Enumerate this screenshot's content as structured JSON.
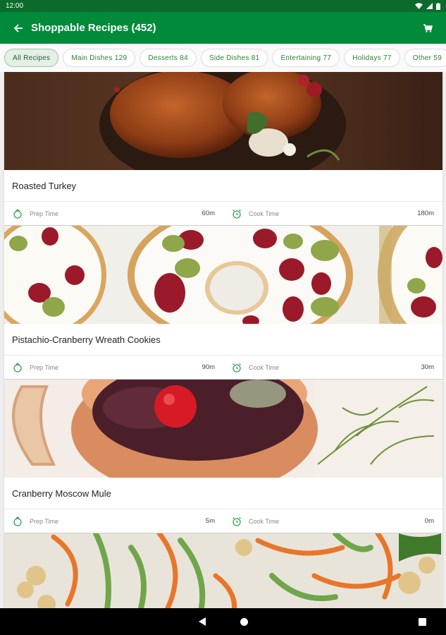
{
  "status_bar": {
    "time": "12:00"
  },
  "app_bar": {
    "title": "Shoppable Recipes (452)",
    "back_icon": "arrow-back-icon",
    "cart_icon": "cart-icon"
  },
  "chips": [
    {
      "label": "All Recipes",
      "selected": true
    },
    {
      "label": "Main Dishes 129"
    },
    {
      "label": "Desserts 84"
    },
    {
      "label": "Side Dishes 81"
    },
    {
      "label": "Entertaining 77"
    },
    {
      "label": "Holidays 77"
    },
    {
      "label": "Other 59"
    }
  ],
  "recipes": [
    {
      "title": "Roasted Turkey",
      "prep_label": "Prep Time",
      "prep_value": "60m",
      "cook_label": "Cook Time",
      "cook_value": "180m"
    },
    {
      "title": "Pistachio-Cranberry Wreath Cookies",
      "prep_label": "Prep Time",
      "prep_value": "90m",
      "cook_label": "Cook Time",
      "cook_value": "30m"
    },
    {
      "title": "Cranberry Moscow Mule",
      "prep_label": "Prep Time",
      "prep_value": "5m",
      "cook_label": "Cook Time",
      "cook_value": "0m"
    }
  ],
  "colors": {
    "primary": "#008a3a",
    "status_bar": "#0b6b2c",
    "accent_green": "#2e7d32"
  }
}
